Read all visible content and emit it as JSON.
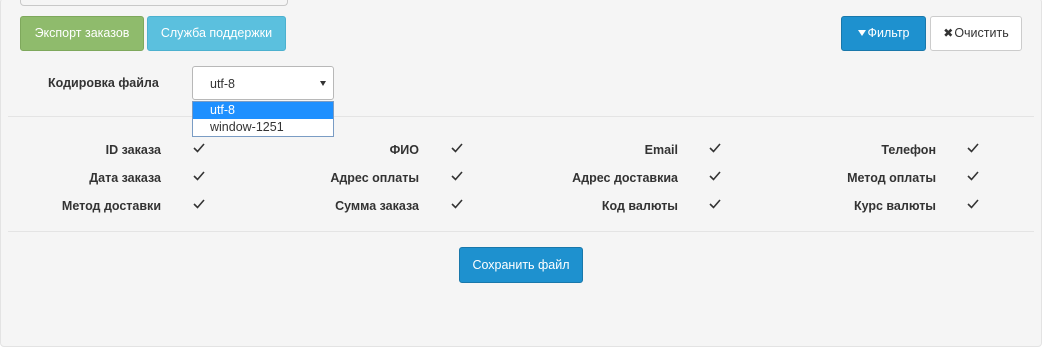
{
  "toolbar": {
    "export_label": "Экспорт заказов",
    "support_label": "Служба поддержки",
    "filter_label": "Фильтр",
    "clear_label": "Очистить"
  },
  "encoding": {
    "label": "Кодировка файла",
    "selected": "utf-8",
    "options": [
      "utf-8",
      "window-1251"
    ]
  },
  "fields": [
    {
      "label": "ID заказа",
      "checked": true
    },
    {
      "label": "ФИО",
      "checked": true
    },
    {
      "label": "Email",
      "checked": true
    },
    {
      "label": "Телефон",
      "checked": true
    },
    {
      "label": "Дата заказа",
      "checked": true
    },
    {
      "label": "Адрес оплаты",
      "checked": true
    },
    {
      "label": "Адрес доставкиа",
      "checked": true
    },
    {
      "label": "Метод оплаты",
      "checked": true
    },
    {
      "label": "Метод доставки",
      "checked": true
    },
    {
      "label": "Сумма заказа",
      "checked": true
    },
    {
      "label": "Код валюты",
      "checked": true
    },
    {
      "label": "Курс валюты",
      "checked": true
    }
  ],
  "save_label": "Сохранить файл",
  "colors": {
    "primary": "#1e91cf",
    "success": "#8fbb6c",
    "info": "#5bc0de",
    "dropdown_selected": "#1e90ff"
  },
  "icons": {
    "filter": "funnel-icon",
    "clear": "close-icon",
    "select_arrow": "caret-down-icon",
    "checkbox": "checkmark-icon"
  }
}
